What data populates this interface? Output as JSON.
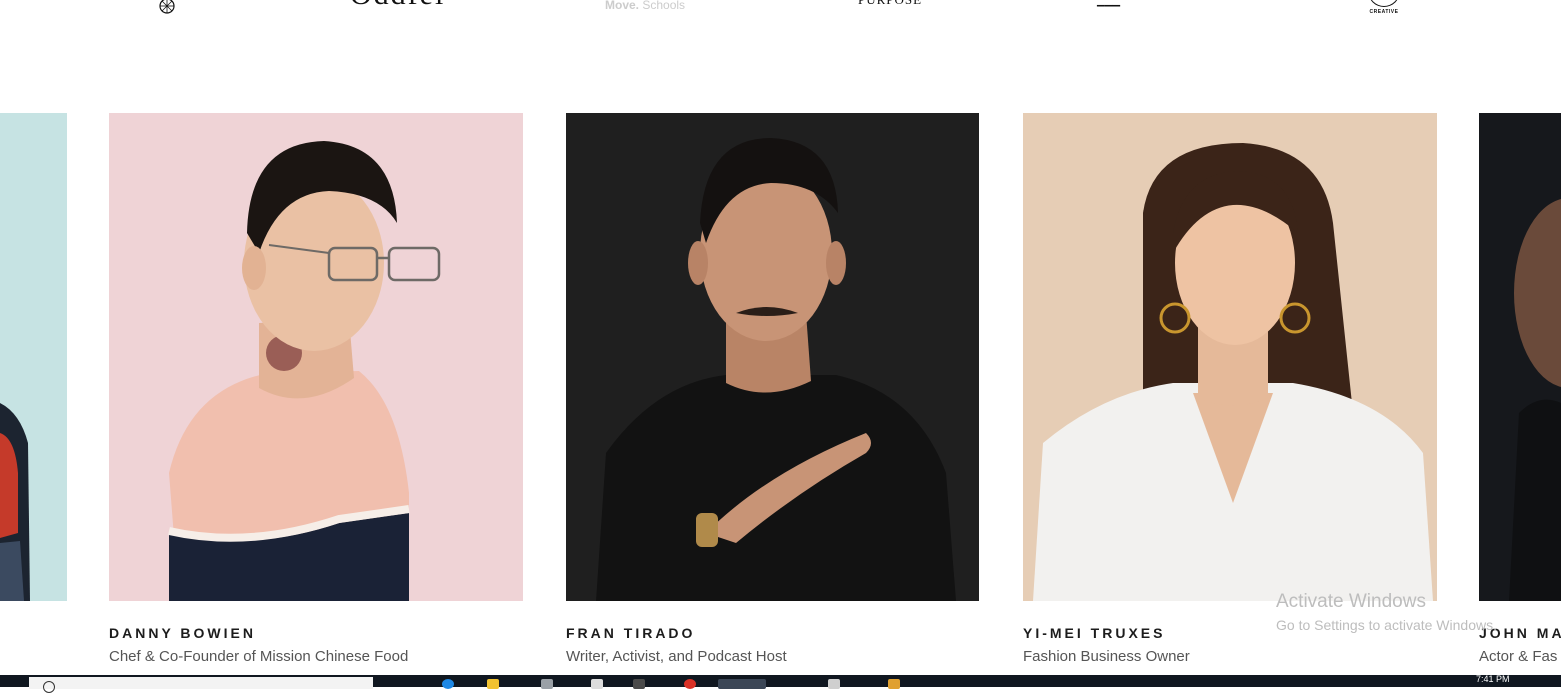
{
  "logos": {
    "logo_2_text": "Oddfel",
    "logo_3_bold": "Move.",
    "logo_3_light": "Schools",
    "logo_4_text": "PURPOSE",
    "logo_5_text": "▁▁▁",
    "logo_6_caption": "CREATIVE"
  },
  "people": [
    {
      "name": "",
      "role": ""
    },
    {
      "name": "DANNY BOWIEN",
      "role": "Chef & Co-Founder of Mission Chinese Food"
    },
    {
      "name": "FRAN TIRADO",
      "role": "Writer, Activist, and Podcast Host"
    },
    {
      "name": "YI-MEI TRUXES",
      "role": "Fashion Business Owner"
    },
    {
      "name": "JOHN MA",
      "role": "Actor & Fas"
    }
  ],
  "watermark": {
    "title": "Activate Windows",
    "subtitle": "Go to Settings to activate Windows."
  },
  "taskbar": {
    "clock": "7:41 PM"
  },
  "colors": {
    "pink_bg": "#efd3d6",
    "dark_bg": "#1f1f1f",
    "beige_bg": "#e6cdb5",
    "teal_bg": "#c6e3e3",
    "taskbar": "#101720"
  }
}
